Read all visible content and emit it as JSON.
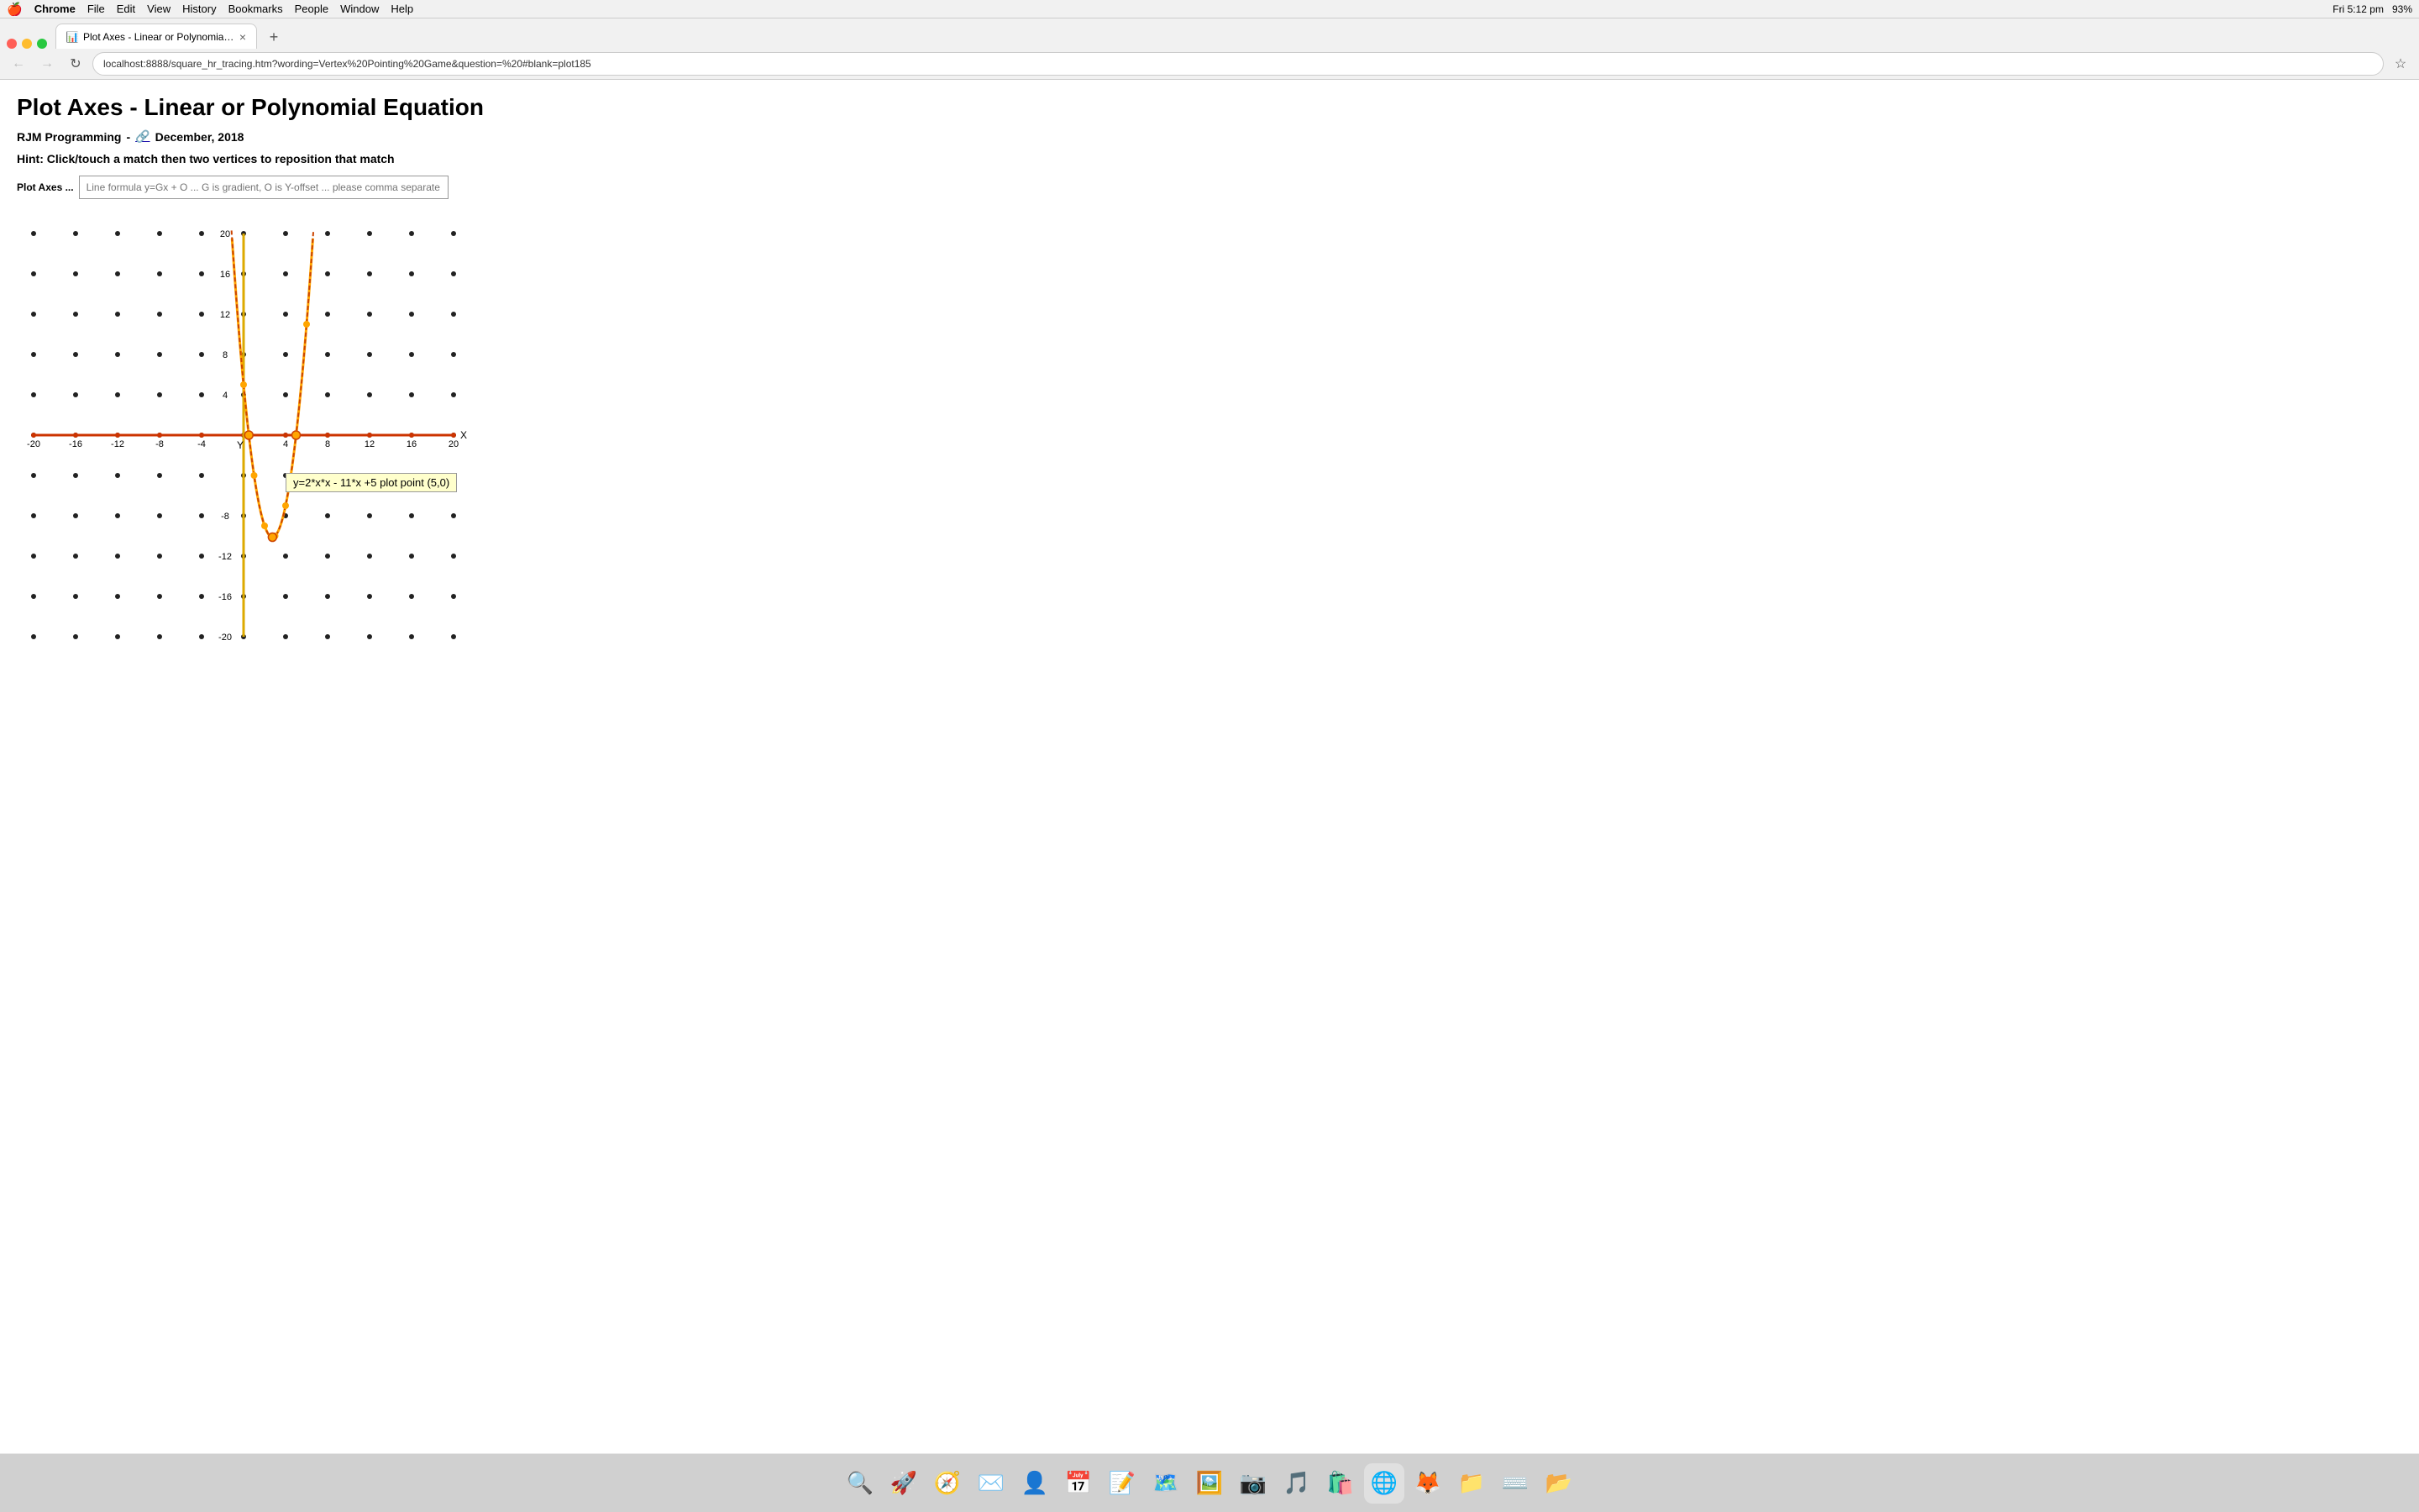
{
  "menubar": {
    "apple": "🍎",
    "items": [
      "Chrome",
      "File",
      "Edit",
      "View",
      "History",
      "Bookmarks",
      "People",
      "Window",
      "Help"
    ],
    "time": "Fri 5:12 pm",
    "battery": "93%"
  },
  "tab": {
    "title": "Plot Axes - Linear or Polynomial Equation",
    "favicon": "📊"
  },
  "nav": {
    "url": "localhost:8888/square_hr_tracing.htm?wording=Vertex%20Pointing%20Game&question=%20#blank=plot185",
    "back_disabled": true,
    "forward_disabled": true
  },
  "page": {
    "title": "Plot Axes - Linear or Polynomial Equation",
    "author": "RJM Programming",
    "author_link_icon": "🔗",
    "date": "December, 2018",
    "hint": "Hint: Click/touch a match then two vertices to reposition that match",
    "plot_label": "Plot Axes ...",
    "plot_placeholder": "Line formula y=Gx + O ... G is gradient, O is Y-offset ... please comma separate G,O",
    "tooltip_text": "y=2*x*x - 11*x +5 plot point (5,0)"
  },
  "graph": {
    "x_min": -20,
    "x_max": 20,
    "y_min": -20,
    "y_max": 20,
    "x_labels": [
      -20,
      -16,
      -12,
      -8,
      -4,
      4,
      8,
      12,
      16,
      20
    ],
    "y_labels": [
      20,
      16,
      12,
      8,
      4,
      -8,
      -12,
      -16,
      -20
    ],
    "x_axis_label": "X",
    "y_axis_label": "Y"
  }
}
